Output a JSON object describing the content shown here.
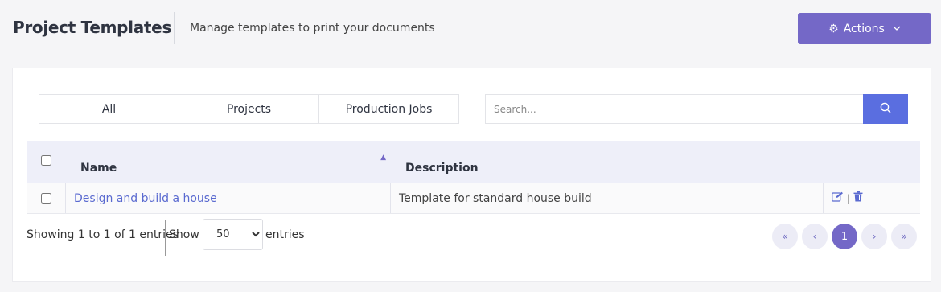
{
  "header": {
    "title": "Project Templates",
    "subtitle": "Manage templates to print your documents",
    "actions_label": "Actions"
  },
  "tabs": [
    {
      "label": "All"
    },
    {
      "label": "Projects"
    },
    {
      "label": "Production Jobs"
    }
  ],
  "search": {
    "placeholder": "Search...",
    "value": ""
  },
  "table": {
    "columns": {
      "name": "Name",
      "description": "Description"
    },
    "sort": {
      "column": "name",
      "direction": "ascending"
    },
    "rows": [
      {
        "name": "Design and build a house",
        "description": "Template for standard house build",
        "checked": false
      }
    ]
  },
  "footer": {
    "info": "Showing 1 to 1 of 1 entries",
    "show_label": "Show",
    "page_size": "50",
    "page_size_options": [
      "50"
    ],
    "entries_label": "entries"
  },
  "pagination": {
    "first": "«",
    "prev": "‹",
    "current": "1",
    "next": "›",
    "last": "»"
  },
  "colors": {
    "accent": "#7468c7",
    "search_button": "#5a6ee0",
    "link": "#5a6ad0",
    "header_bg": "#eeeff9"
  }
}
